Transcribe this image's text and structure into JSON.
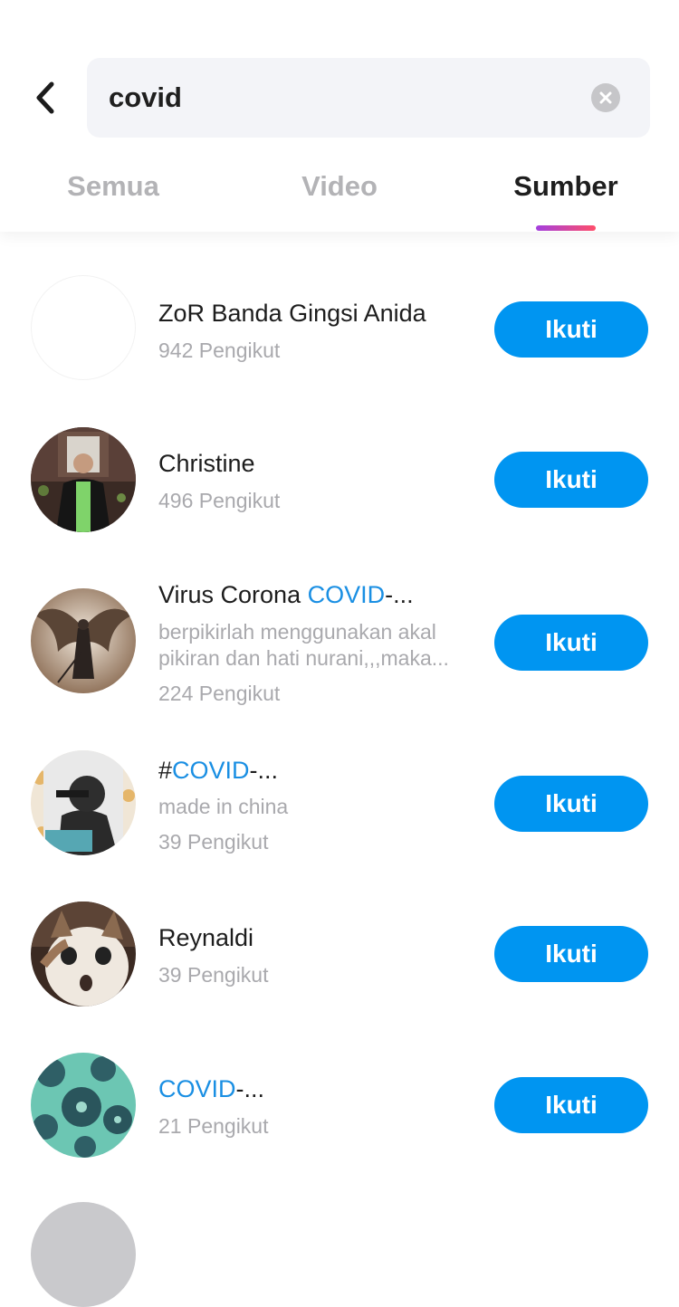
{
  "search": {
    "query": "covid"
  },
  "tabs": [
    {
      "label": "Semua"
    },
    {
      "label": "Video"
    },
    {
      "label": "Sumber"
    }
  ],
  "results": [
    {
      "name": "ZoR Banda Gingsi Anida",
      "followers": "942 Pengikut",
      "button": "Ikuti"
    },
    {
      "name": "Christine",
      "followers": "496 Pengikut",
      "button": "Ikuti"
    },
    {
      "name_prefix": "Virus Corona ",
      "name_highlight": "COVID",
      "name_suffix": "-...",
      "desc_line1": "berpikirlah menggunakan akal",
      "desc_line2": "pikiran dan hati nurani,,,maka...",
      "followers": "224 Pengikut",
      "button": "Ikuti"
    },
    {
      "name_prefix": "#",
      "name_highlight": "COVID",
      "name_suffix": "-...",
      "desc_line1": "made in china",
      "followers": "39 Pengikut",
      "button": "Ikuti"
    },
    {
      "name": "Reynaldi",
      "followers": "39 Pengikut",
      "button": "Ikuti"
    },
    {
      "name_highlight": "COVID",
      "name_suffix": "-...",
      "followers": "21 Pengikut",
      "button": "Ikuti"
    }
  ],
  "colors": {
    "accent": "#0095f1",
    "highlight": "#1a8fe3",
    "tab_indicator_start": "#a33fde",
    "tab_indicator_end": "#ff4e6a"
  }
}
